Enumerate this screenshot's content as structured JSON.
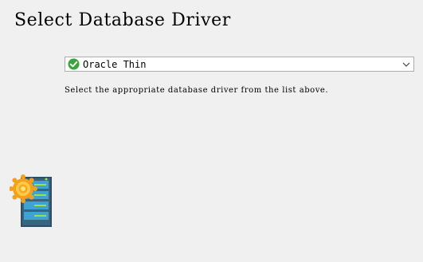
{
  "page": {
    "title": "Select Database Driver"
  },
  "driver": {
    "selected": "Oracle Thin",
    "status_icon": "check-circle-icon",
    "status_color": "#3aa53a",
    "dropdown_icon": "chevron-down-icon"
  },
  "hint": "Select the appropriate database driver from the list above.",
  "graphic": {
    "icon": "database-server-icon",
    "accent_color": "#f0a020"
  }
}
